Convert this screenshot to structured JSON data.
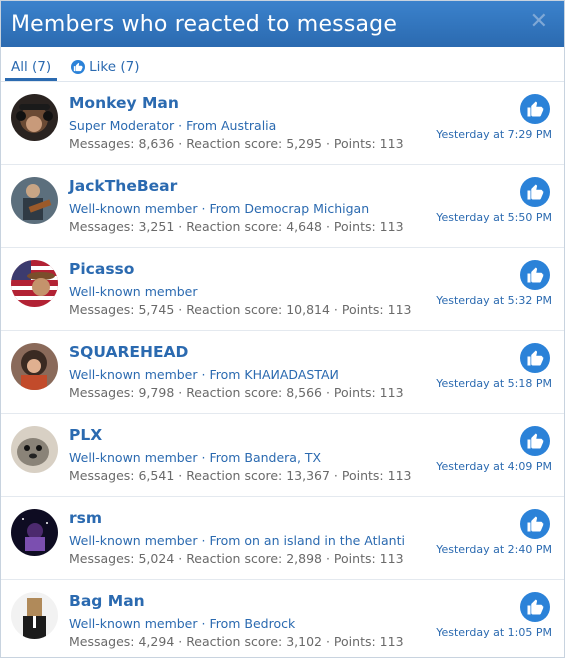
{
  "dialog": {
    "title": "Members who reacted to message",
    "close_icon": "close-icon"
  },
  "tabs": [
    {
      "label": "All (7)",
      "active": true
    },
    {
      "label": "Like (7)",
      "icon": "like-icon"
    }
  ],
  "colors": {
    "accent": "#2b6ab0",
    "like": "#2b82d8",
    "muted": "#6a6a6a"
  },
  "members": [
    {
      "name": "Monkey Man",
      "role": "Super Moderator",
      "location": "From Australia",
      "stats": "Messages: 8,636 · Reaction score: 5,295 · Points: 113",
      "time": "Yesterday at 7:29 PM",
      "avatar": "monkey-avatar"
    },
    {
      "name": "JackTheBear",
      "role": "Well-known member",
      "location": "From Democrap Michigan",
      "stats": "Messages: 3,251 · Reaction score: 4,648 · Points: 113",
      "time": "Yesterday at 5:50 PM",
      "avatar": "guitarist-avatar"
    },
    {
      "name": "Picasso",
      "role": "Well-known member",
      "location": "",
      "stats": "Messages: 5,745 · Reaction score: 10,814 · Points: 113",
      "time": "Yesterday at 5:32 PM",
      "avatar": "flag-cowboy-avatar"
    },
    {
      "name": "SQUAREHEAD",
      "role": "Well-known member",
      "location": "From KHAИADASTAИ",
      "stats": "Messages: 9,798 · Reaction score: 8,566 · Points: 113",
      "time": "Yesterday at 5:18 PM",
      "avatar": "rocker-avatar"
    },
    {
      "name": "PLX",
      "role": "Well-known member",
      "location": "From Bandera, TX",
      "stats": "Messages: 6,541 · Reaction score: 13,367 · Points: 113",
      "time": "Yesterday at 4:09 PM",
      "avatar": "seal-avatar"
    },
    {
      "name": "rsm",
      "role": "Well-known member",
      "location": "From on an island in the Atlanti",
      "stats": "Messages: 5,024 · Reaction score: 2,898 · Points: 113",
      "time": "Yesterday at 2:40 PM",
      "avatar": "space-avatar"
    },
    {
      "name": "Bag Man",
      "role": "Well-known member",
      "location": "From Bedrock",
      "stats": "Messages: 4,294 · Reaction score: 3,102 · Points: 113",
      "time": "Yesterday at 1:05 PM",
      "avatar": "bagman-avatar"
    }
  ]
}
